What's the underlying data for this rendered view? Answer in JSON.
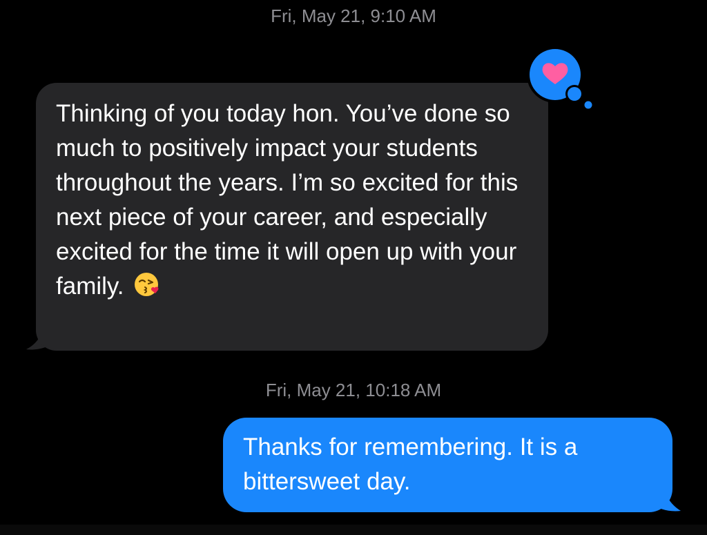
{
  "conversation": {
    "messages": [
      {
        "timestamp": "Fri, May 21, 9:10 AM",
        "direction": "incoming",
        "text": "Thinking of you today hon. You’ve done so much to positively impact your students throughout the years. I’m so excited for this next piece of your career, and especially excited for the time it will open up with your family.",
        "emoji_icon": "face-blowing-kiss-icon",
        "reaction_icon": "heart-icon",
        "bubble_color": "#262628",
        "reaction_color": "#1a87fc",
        "heart_color": "#ff5fa2"
      },
      {
        "timestamp": "Fri, May 21, 10:18 AM",
        "direction": "outgoing",
        "text": "Thanks for remembering. It is a bittersweet day.",
        "bubble_color": "#1a87fc"
      }
    ]
  },
  "colors": {
    "background": "#000000",
    "timestamp_text": "#8e8e93"
  }
}
